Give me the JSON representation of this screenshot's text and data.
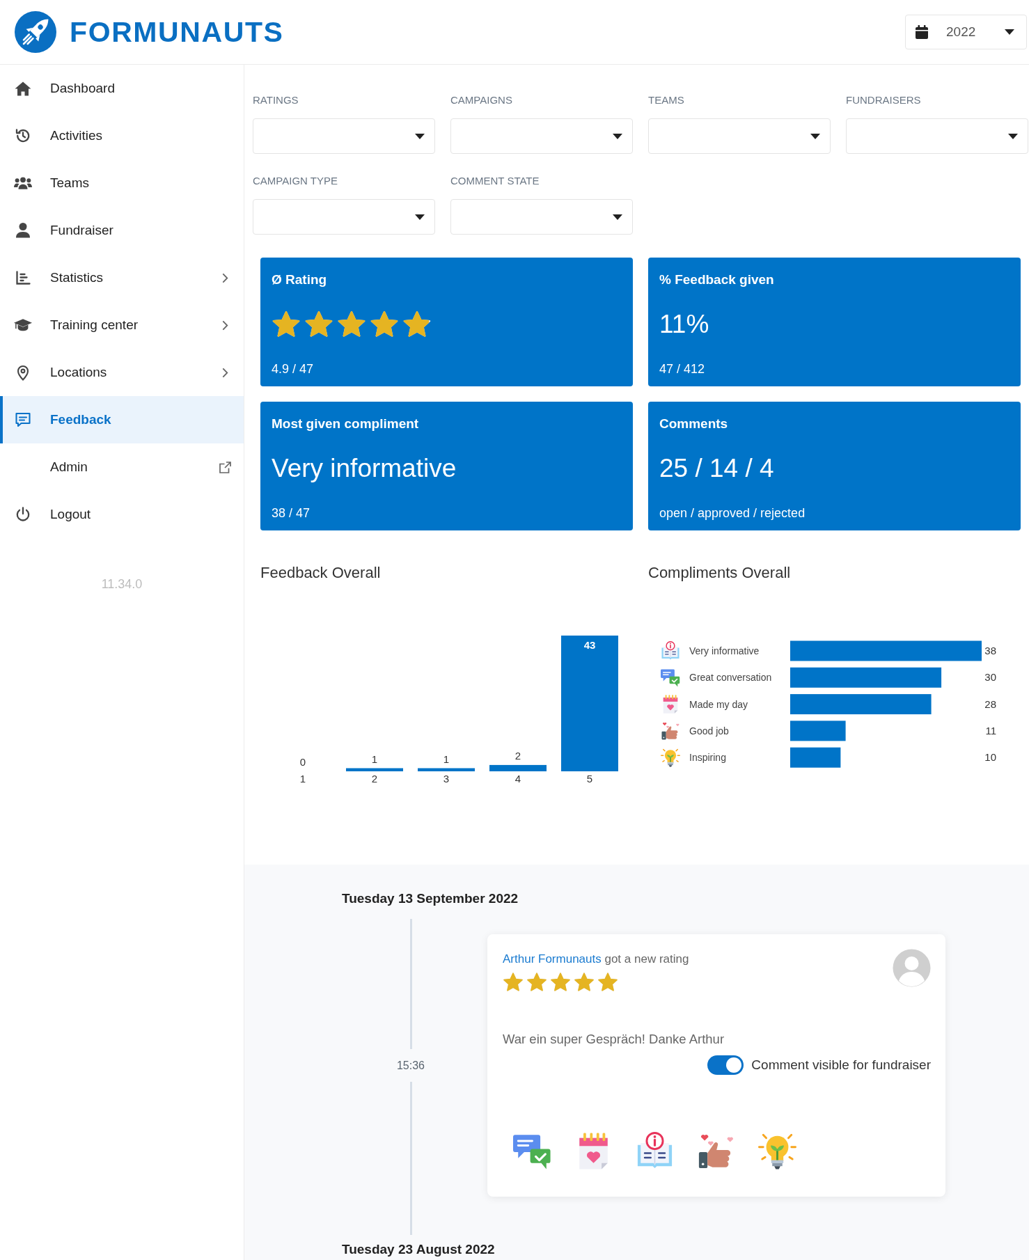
{
  "header": {
    "logo_text": "FORMUNAUTS",
    "year_select": {
      "value": "2022"
    }
  },
  "sidebar": {
    "items": [
      {
        "label": "Dashboard",
        "kind": "link",
        "selected": false
      },
      {
        "label": "Activities",
        "kind": "link",
        "selected": false
      },
      {
        "label": "Teams",
        "kind": "link",
        "selected": false
      },
      {
        "label": "Fundraiser",
        "kind": "link",
        "selected": false
      },
      {
        "label": "Statistics",
        "kind": "submenu",
        "selected": false
      },
      {
        "label": "Training center",
        "kind": "submenu",
        "selected": false
      },
      {
        "label": "Locations",
        "kind": "submenu",
        "selected": false
      },
      {
        "label": "Feedback",
        "kind": "link",
        "selected": true
      },
      {
        "label": "Admin",
        "kind": "external",
        "selected": false
      },
      {
        "label": "Logout",
        "kind": "link",
        "selected": false
      }
    ],
    "version": "11.34.0"
  },
  "filters": [
    {
      "label": "RATINGS"
    },
    {
      "label": "CAMPAIGNS"
    },
    {
      "label": "TEAMS"
    },
    {
      "label": "FUNDRAISERS"
    },
    {
      "label": "CAMPAIGN TYPE"
    },
    {
      "label": "COMMENT STATE"
    }
  ],
  "stat_cards": [
    {
      "kind": "stars",
      "title": "Ø Rating",
      "stars": 4.9,
      "footer": "4.9 / 47"
    },
    {
      "kind": "value",
      "title": "% Feedback given",
      "value": "11%",
      "footer": "47 / 412"
    },
    {
      "kind": "value",
      "title": "Most given compliment",
      "value": "Very informative",
      "footer": "38 / 47"
    },
    {
      "kind": "value",
      "title": "Comments",
      "value": "25 / 14 / 4",
      "footer": "open / approved / rejected"
    }
  ],
  "feedback_overall": {
    "title": "Feedback Overall",
    "chart_data": {
      "type": "bar",
      "orientation": "vertical",
      "categories": [
        "1",
        "2",
        "3",
        "4",
        "5"
      ],
      "values": [
        0,
        1,
        1,
        2,
        43
      ],
      "data_labels": true
    }
  },
  "compliments_overall": {
    "title": "Compliments Overall",
    "row_icons": [
      {
        "kind": "info"
      },
      {
        "kind": "conversation"
      },
      {
        "kind": "calendar"
      },
      {
        "kind": "thumbs"
      },
      {
        "kind": "bulb"
      }
    ],
    "chart_data": {
      "type": "bar",
      "orientation": "horizontal",
      "categories": [
        "Very informative",
        "Great conversation",
        "Made my day",
        "Good job",
        "Inspiring"
      ],
      "values": [
        38,
        30,
        28,
        11,
        10
      ],
      "data_labels": true
    }
  },
  "timeline": [
    {
      "date": "Tuesday 13 September 2022",
      "entries": [
        {
          "time": "15:36",
          "person": "Arthur Formunauts",
          "action": "got a new rating",
          "stars": 5,
          "comment": "War ein super Gespräch! Danke Arthur",
          "toggle": {
            "label": "Comment visible for fundraiser",
            "on": true
          },
          "compliments": [
            {
              "kind": "conversation"
            },
            {
              "kind": "calendar"
            },
            {
              "kind": "info"
            },
            {
              "kind": "thumbs"
            },
            {
              "kind": "bulb"
            }
          ]
        }
      ]
    },
    {
      "date": "Tuesday 23 August 2022"
    }
  ]
}
